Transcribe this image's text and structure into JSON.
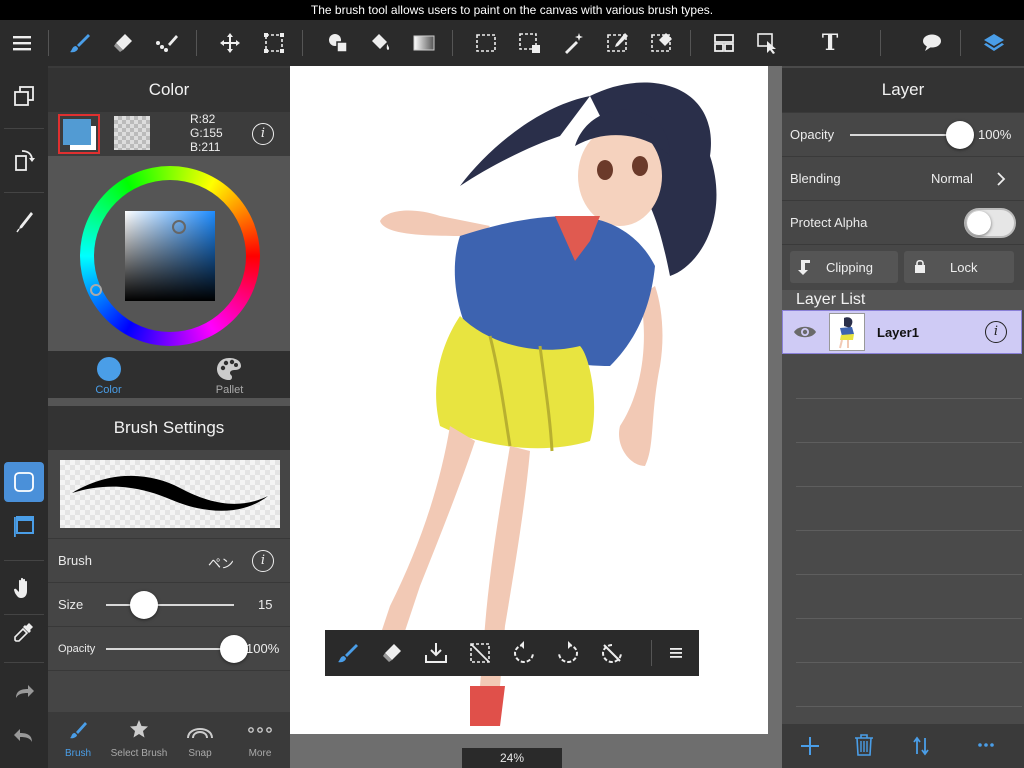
{
  "caption": "The brush tool allows users to paint on the canvas with various brush types.",
  "toolbar": {
    "icons": [
      "menu-icon",
      "brush-icon",
      "eraser-icon",
      "smudge-icon",
      "move-icon",
      "transform-icon",
      "shape-icon",
      "fill-bucket-icon",
      "gradient-icon",
      "rect-select-icon",
      "select-pen-icon",
      "magic-wand-icon",
      "select-draw-icon",
      "select-erase-icon",
      "panel-layout-icon",
      "select-cursor-icon",
      "text-icon",
      "speech-bubble-icon",
      "layers-icon"
    ],
    "text_label": "T"
  },
  "color_panel": {
    "title": "Color",
    "rgb_r": "R:82",
    "rgb_g": "G:155",
    "rgb_b": "B:211",
    "main_color": "#529bd3",
    "tabs": [
      {
        "label": "Color",
        "active": true
      },
      {
        "label": "Pallet",
        "active": false
      }
    ]
  },
  "brush_panel": {
    "title": "Brush Settings",
    "brush_label": "Brush",
    "brush_value": "ペン",
    "size_label": "Size",
    "size_value": "15",
    "size_fraction": 0.3,
    "opacity_label": "Opacity",
    "opacity_value": "100%",
    "opacity_fraction": 1.0,
    "bottom_tabs": [
      {
        "label": "Brush",
        "active": true
      },
      {
        "label": "Select Brush",
        "active": false
      },
      {
        "label": "Snap",
        "active": false
      },
      {
        "label": "More",
        "active": false
      }
    ]
  },
  "layer_panel": {
    "title": "Layer",
    "opacity_label": "Opacity",
    "opacity_value": "100%",
    "opacity_fraction": 1.0,
    "blending_label": "Blending",
    "blending_value": "Normal",
    "protect_alpha_label": "Protect Alpha",
    "protect_alpha_on": false,
    "clipping_label": "Clipping",
    "lock_label": "Lock",
    "list_title": "Layer List",
    "layers": [
      {
        "name": "Layer1",
        "visible": true,
        "selected": true
      }
    ]
  },
  "float_bar": {
    "icons": [
      "brush-icon",
      "eraser-icon",
      "import-icon",
      "deselect-icon",
      "undo-icon",
      "redo-icon",
      "rotate-reset-icon",
      "menu-icon"
    ]
  },
  "zoom": "24%",
  "colors": {
    "accent": "#4a9ee8",
    "selected_layer": "#cfcbf5",
    "active_side_tool": "#4a90d9"
  }
}
